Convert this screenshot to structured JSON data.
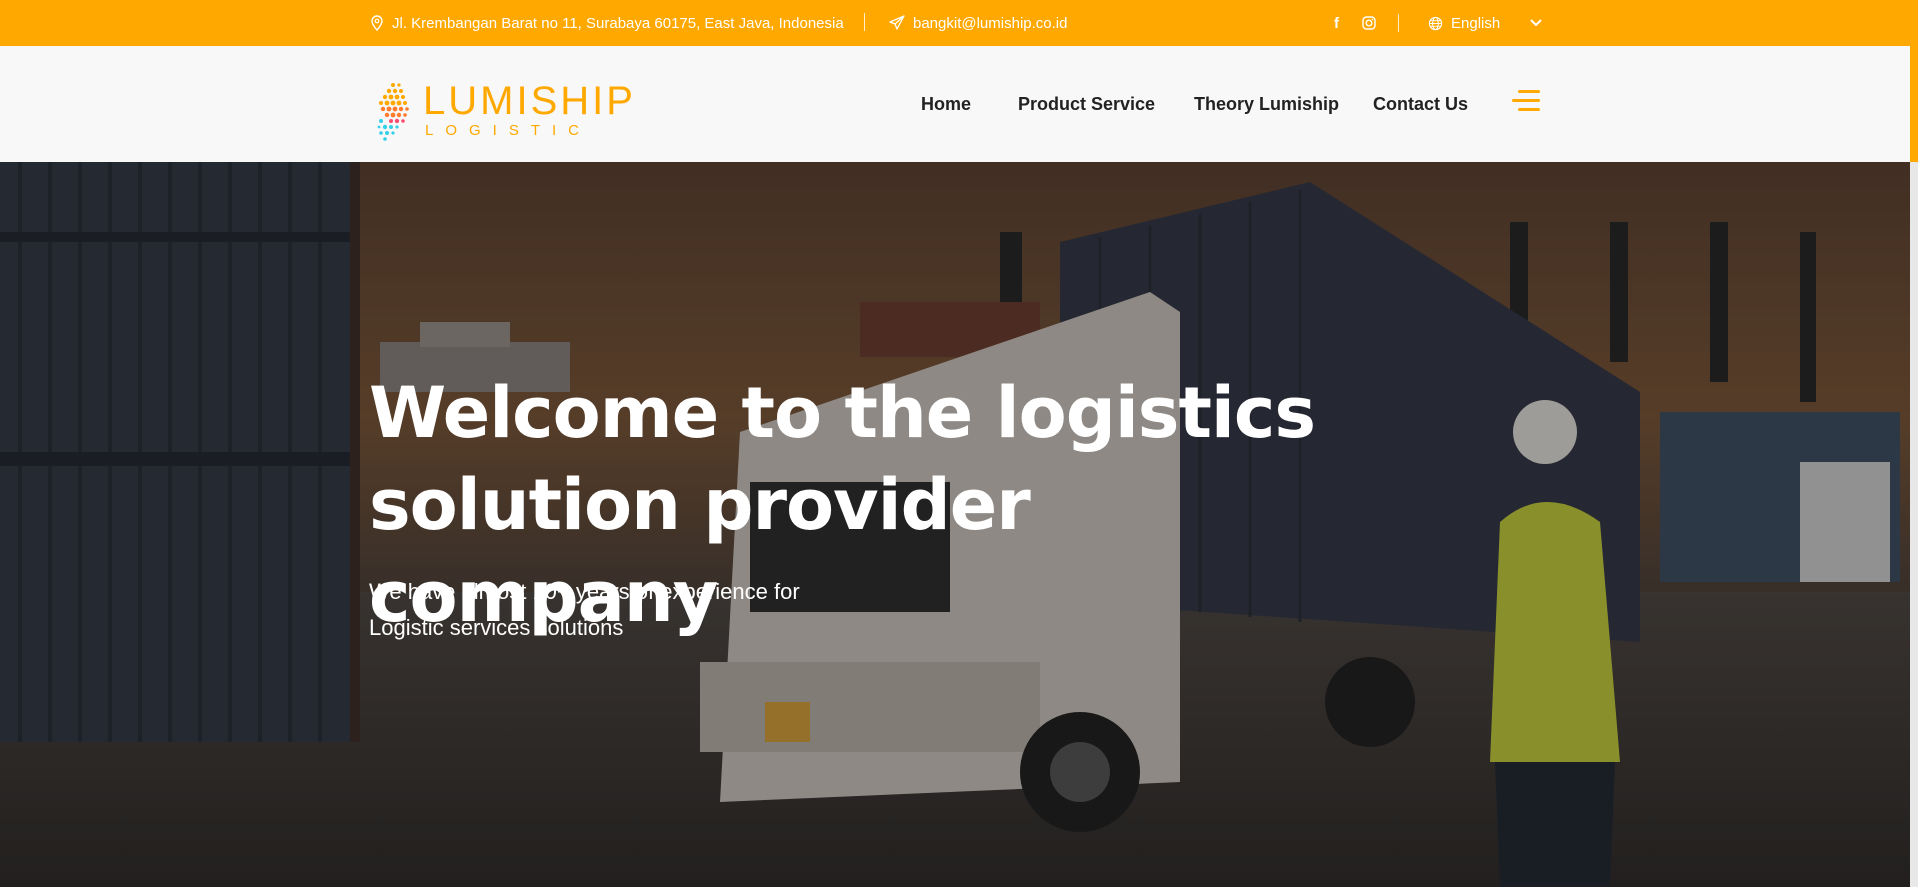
{
  "topbar": {
    "address": "Jl. Krembangan Barat no 11, Surabaya 60175, East Java, Indonesia",
    "email": "bangkit@lumiship.co.id",
    "facebook_icon": "facebook-icon",
    "instagram_icon": "instagram-icon",
    "language": "English",
    "colors": {
      "background": "#ffa800",
      "text": "#ffffff"
    }
  },
  "header": {
    "logo": {
      "word": "LUMISHIP",
      "sub": "LOGISTIC"
    },
    "nav": [
      {
        "label": "Home"
      },
      {
        "label": "Product Service"
      },
      {
        "label": "Theory Lumiship"
      },
      {
        "label": "Contact Us"
      }
    ],
    "menu_icon": "hamburger-menu-icon",
    "colors": {
      "background": "#f8f8f8",
      "accent": "#ffa800"
    }
  },
  "hero": {
    "title_line1": "Welcome to the logistics",
    "title_line2": "solution provider company",
    "subtitle_line1": "We have almost 10+ years of experience for",
    "subtitle_line2": "Logistic services solutions"
  }
}
